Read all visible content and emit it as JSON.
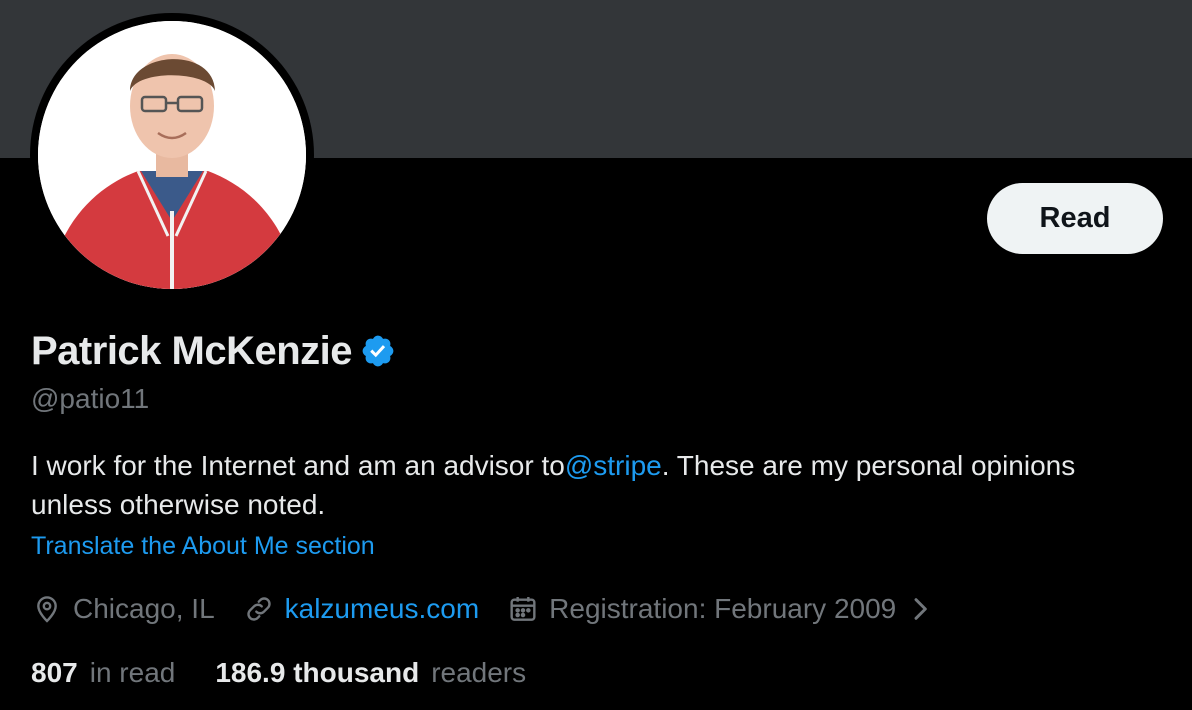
{
  "profile": {
    "name": "Patrick McKenzie",
    "handle": "@patio11",
    "bio_prefix": "I work for the Internet and am an advisor to",
    "bio_mention": "@stripe",
    "bio_suffix": ". These are my personal opinions unless otherwise noted.",
    "translate_label": "Translate the About Me section",
    "location": "Chicago, IL",
    "website": "kalzumeus.com",
    "registration": "Registration: February 2009",
    "verified": true
  },
  "actions": {
    "read_label": "Read"
  },
  "stats": {
    "following_value": "807",
    "following_label": "in read",
    "followers_value": "186.9 thousand",
    "followers_label": "readers"
  },
  "icons": {
    "location": "location-pin-icon",
    "link": "link-icon",
    "calendar": "calendar-icon",
    "verified": "verified-badge-icon",
    "chevron": "chevron-right-icon"
  },
  "colors": {
    "background": "#000000",
    "banner": "#333639",
    "accent": "#1d9bf0",
    "text_primary": "#e7e9ea",
    "text_secondary": "#71767b",
    "button_bg": "#eff3f4"
  }
}
